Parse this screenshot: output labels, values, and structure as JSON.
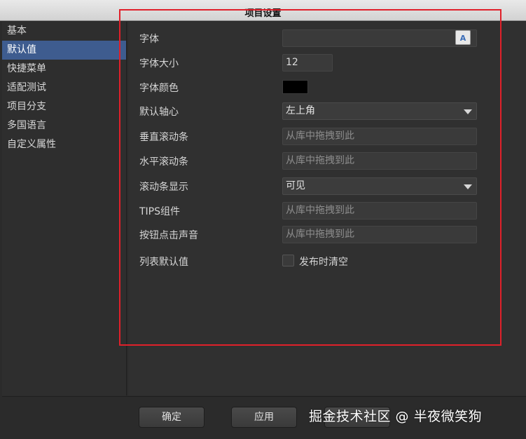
{
  "window": {
    "title": "项目设置"
  },
  "sidebar": {
    "items": [
      {
        "label": "基本"
      },
      {
        "label": "默认值"
      },
      {
        "label": "快捷菜单"
      },
      {
        "label": "适配测试"
      },
      {
        "label": "项目分支"
      },
      {
        "label": "多国语言"
      },
      {
        "label": "自定义属性"
      }
    ],
    "active": "默认值"
  },
  "form": {
    "font": {
      "label": "字体",
      "value": "",
      "button_glyph": "A"
    },
    "font_size": {
      "label": "字体大小",
      "value": "12"
    },
    "font_color": {
      "label": "字体颜色",
      "color": "#000000"
    },
    "pivot": {
      "label": "默认轴心",
      "value": "左上角"
    },
    "vscroll": {
      "label": "垂直滚动条",
      "placeholder": "从库中拖拽到此"
    },
    "hscroll": {
      "label": "水平滚动条",
      "placeholder": "从库中拖拽到此"
    },
    "scrollbar_display": {
      "label": "滚动条显示",
      "value": "可见"
    },
    "tips": {
      "label": "TIPS组件",
      "placeholder": "从库中拖拽到此"
    },
    "click_sound": {
      "label": "按钮点击声音",
      "placeholder": "从库中拖拽到此"
    },
    "list_default": {
      "label": "列表默认值",
      "checkbox_label": "发布时清空",
      "checked": false
    }
  },
  "footer": {
    "ok_label": "确定",
    "apply_label": "应用"
  },
  "watermark": "掘金技术社区 @ 半夜微笑狗"
}
